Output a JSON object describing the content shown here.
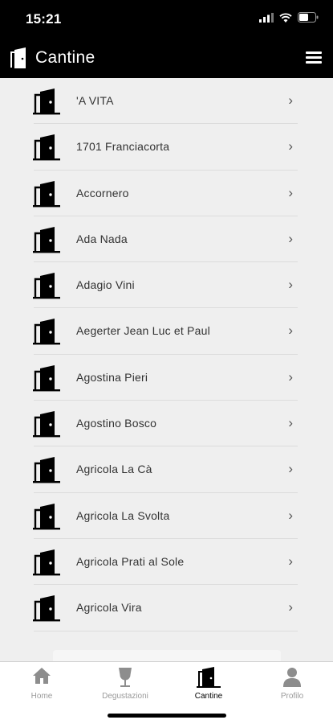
{
  "status_bar": {
    "time": "15:21"
  },
  "header": {
    "title": "Cantine"
  },
  "list": {
    "items": [
      "'A VITA",
      "1701 Franciacorta",
      "Accornero",
      "Ada Nada",
      "Adagio Vini",
      "Aegerter Jean Luc et Paul",
      "Agostina Pieri",
      "Agostino Bosco",
      "Agricola La Cà",
      "Agricola La Svolta",
      "Agricola Prati al Sole",
      "Agricola Vira"
    ],
    "chevron": "›"
  },
  "tabs": [
    {
      "label": "Home",
      "icon": "home-icon"
    },
    {
      "label": "Degustazioni",
      "icon": "wine-glass-icon"
    },
    {
      "label": "Cantine",
      "icon": "winery-door-icon",
      "active": true
    },
    {
      "label": "Profilo",
      "icon": "user-icon"
    }
  ],
  "colors": {
    "bar_background": "#000000",
    "page_background": "#efefef",
    "active_tab": "#000000",
    "inactive_tab": "#9a9a9a"
  }
}
